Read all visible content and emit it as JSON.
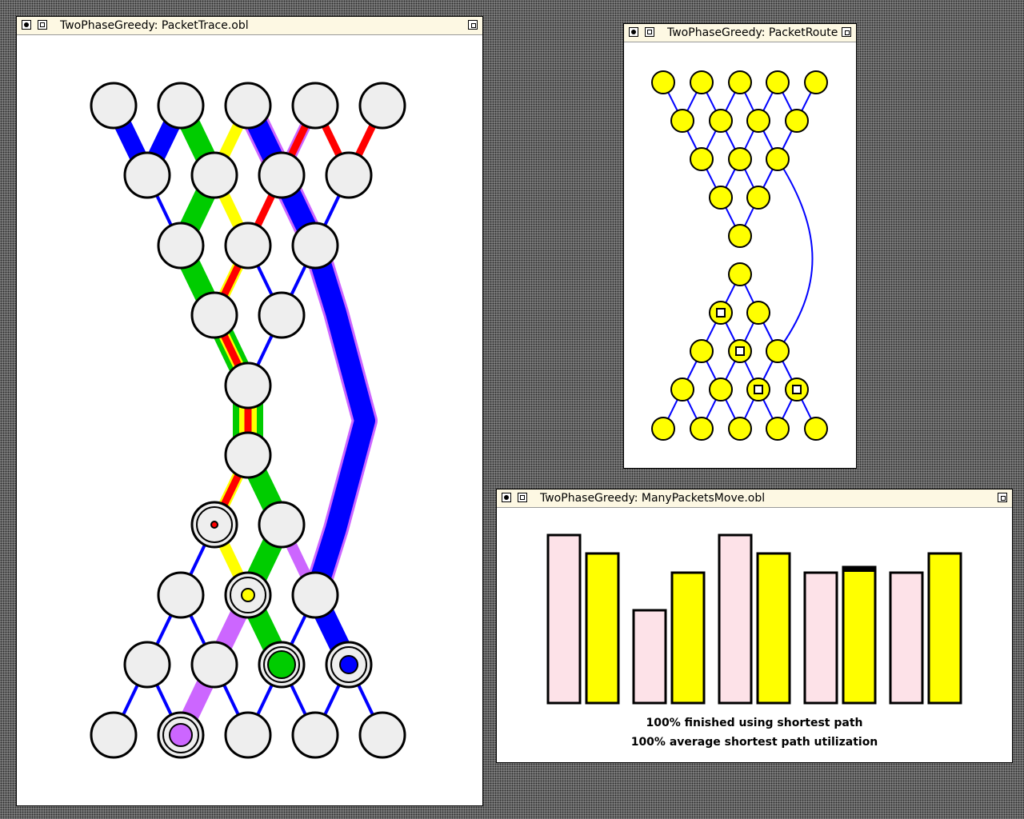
{
  "windows": {
    "trace": {
      "title": "TwoPhaseGreedy: PacketTrace.obl"
    },
    "route": {
      "title": "TwoPhaseGreedy: PacketRoute"
    },
    "many": {
      "title": "TwoPhaseGreedy: ManyPacketsMove.obl",
      "stat_finished": "100% finished using shortest path",
      "stat_utilization": "100% average shortest path utilization"
    }
  },
  "colors": {
    "background": "#8e8e8e",
    "titlebar": "#fdf8e3",
    "node_fill": "#eeeeee",
    "route_node": "#ffff00",
    "packet_blue": "#0000ff",
    "packet_green": "#00cc00",
    "packet_yellow": "#ffff00",
    "packet_red": "#ff0000",
    "packet_violet": "#cc66ff",
    "bar_pink": "#fde2e8",
    "bar_yellow": "#ffff00"
  },
  "chart_data": {
    "type": "bar",
    "series": [
      {
        "name": "",
        "values": [
          210,
          116,
          210,
          163,
          163
        ]
      },
      {
        "name": "",
        "values": [
          187,
          163,
          187,
          170,
          187
        ]
      }
    ],
    "ylim": [
      0,
      215
    ]
  }
}
